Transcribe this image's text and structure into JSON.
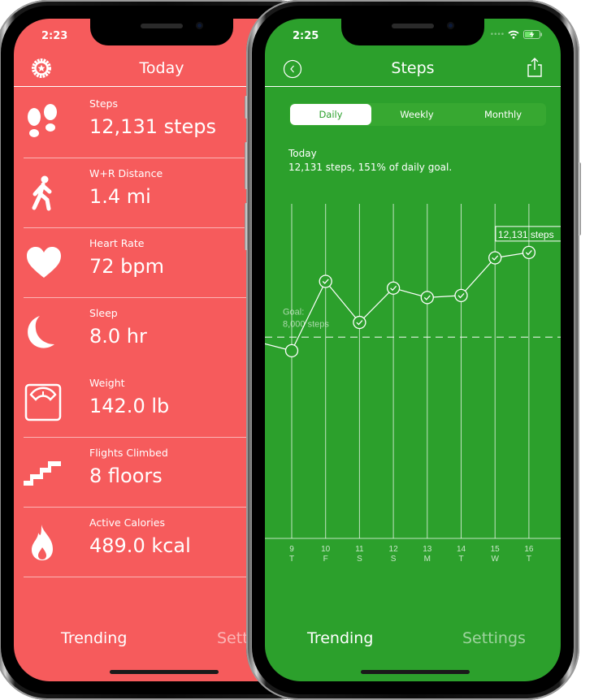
{
  "left_screen": {
    "status_time": "2:23",
    "nav_title": "Today",
    "metrics": [
      {
        "icon": "footprints-icon",
        "label": "Steps",
        "value": "12,131 steps"
      },
      {
        "icon": "walking-person-icon",
        "label": "W+R Distance",
        "value": "1.4 mi"
      },
      {
        "icon": "heart-icon",
        "label": "Heart Rate",
        "value": "72 bpm"
      },
      {
        "icon": "moon-icon",
        "label": "Sleep",
        "value": "8.0 hr"
      },
      {
        "icon": "scale-icon",
        "label": "Weight",
        "value": "142.0 lb"
      },
      {
        "icon": "stairs-icon",
        "label": "Flights Climbed",
        "value": "8 floors"
      },
      {
        "icon": "flame-icon",
        "label": "Active Calories",
        "value": "489.0 kcal"
      }
    ],
    "tabbar": {
      "trending": "Trending",
      "settings": "Settings"
    },
    "colors": {
      "background": "#f65b5c"
    }
  },
  "right_screen": {
    "status_time": "2:25",
    "nav_title": "Steps",
    "segments": [
      {
        "label": "Daily",
        "active": true
      },
      {
        "label": "Weekly",
        "active": false
      },
      {
        "label": "Monthly",
        "active": false
      }
    ],
    "summary_title": "Today",
    "summary_text": "12,131 steps, 151% of daily goal.",
    "goal_label_line1": "Goal:",
    "goal_label_line2": "8,000 steps",
    "callout": "12,131 steps",
    "tabbar": {
      "trending": "Trending",
      "settings": "Settings"
    },
    "colors": {
      "background": "#2ca02c"
    }
  },
  "chart_data": {
    "type": "line",
    "title": "Steps (Daily)",
    "categories": [
      "9",
      "10",
      "11",
      "12",
      "13",
      "14",
      "15",
      "16"
    ],
    "weekday_labels": [
      "T",
      "F",
      "S",
      "S",
      "M",
      "T",
      "W",
      "T"
    ],
    "series": [
      {
        "name": "Steps",
        "values": [
          7344,
          10722,
          8722,
          10394,
          9935,
          10034,
          11870,
          12131
        ]
      }
    ],
    "previous_value_offscreen": 7770,
    "goal": 8000,
    "goal_met": [
      false,
      true,
      true,
      true,
      true,
      true,
      true,
      true
    ],
    "annotations": [
      "Goal: 8,000 steps",
      "12,131 steps"
    ],
    "xlabel": "",
    "ylabel": "",
    "ylim": [
      -1800,
      14500
    ],
    "grid": "vertical"
  }
}
